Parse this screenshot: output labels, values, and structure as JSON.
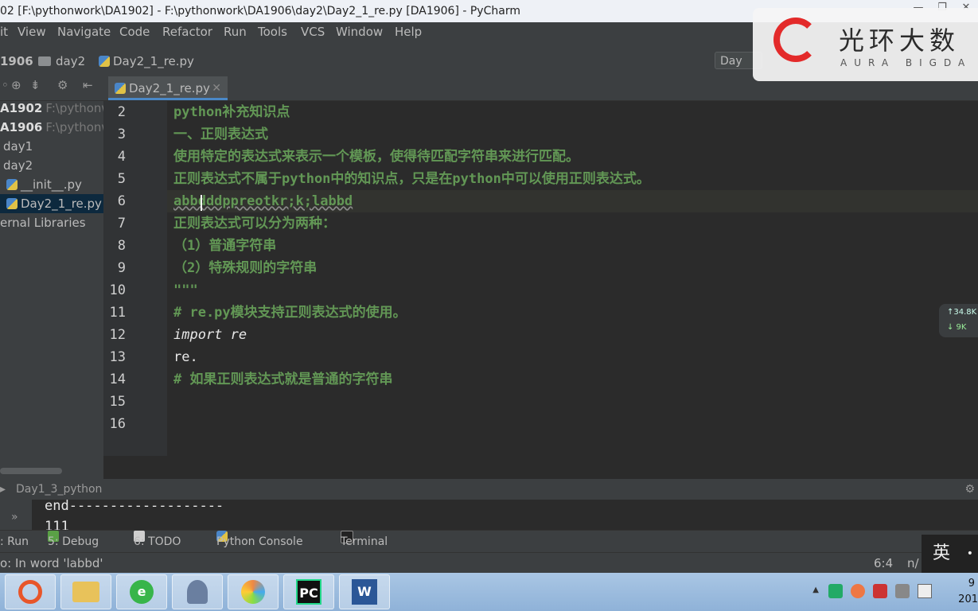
{
  "window": {
    "title": "02 [F:\\pythonwork\\DA1902] - F:\\pythonwork\\DA1906\\day2\\Day2_1_re.py [DA1906] - PyCharm",
    "controls": [
      "—",
      "❐",
      "✕"
    ]
  },
  "menu": [
    "it",
    "View",
    "Navigate",
    "Code",
    "Refactor",
    "Run",
    "Tools",
    "VCS",
    "Window",
    "Help"
  ],
  "nav": {
    "project": "1906",
    "folder": "day2",
    "file": "Day2_1_re.py",
    "run_config": "Day"
  },
  "project_panel": {
    "rows": [
      {
        "name": "A1902",
        "path": "F:\\pythonw"
      },
      {
        "name": "A1906",
        "path": "F:\\pythonw"
      },
      {
        "name": "day1",
        "path": ""
      },
      {
        "name": "day2",
        "path": ""
      },
      {
        "name": "__init__.py",
        "path": ""
      },
      {
        "name": "Day2_1_re.py",
        "path": ""
      },
      {
        "name": "ernal Libraries",
        "path": ""
      }
    ]
  },
  "editor": {
    "tab": "Day2_1_re.py",
    "line_numbers": [
      "2",
      "3",
      "4",
      "5",
      "6",
      "7",
      "8",
      "9",
      "10",
      "11",
      "12",
      "13",
      "14",
      "15",
      "16"
    ],
    "lines": [
      "python补充知识点",
      "一、正则表达式",
      "使用特定的表达式来表示一个模板，使得待匹配字符串来进行匹配。",
      "正则表达式不属于python中的知识点，只是在python中可以使用正则表达式。",
      "abbdddppreotkr;k;labbd",
      "正则表达式可以分为两种：",
      "（1）普通字符串",
      "（2）特殊规则的字符串",
      "\"\"\"",
      "# re.py模块支持正则表达式的使用。",
      "import re",
      "re.",
      "# 如果正则表达式就是普通的字符串",
      "",
      ""
    ]
  },
  "run": {
    "config": "Day1_3_python",
    "output": [
      "end-------------------",
      "111"
    ]
  },
  "toolwindows": [
    {
      "label": ": Run"
    },
    {
      "label": "5: Debug"
    },
    {
      "label": "6: TODO"
    },
    {
      "label": "Python Console"
    },
    {
      "label": "Terminal"
    }
  ],
  "status": {
    "message": "o: In word 'labbd'",
    "position": "6:4",
    "extra": "n/"
  },
  "taskbar": {
    "apps": [
      "Chrome",
      "Explorer",
      "IE",
      "User",
      "Paint",
      "PC",
      "W"
    ],
    "time": "9",
    "date": "201"
  },
  "watermark": {
    "cn": "光环大数",
    "en": "AURA BIGDA"
  },
  "net": {
    "up": "↑34.8K",
    "down": "↓ 9K"
  },
  "ime": "英",
  "colors": {
    "editor_bg": "#2b2b2b",
    "docstring": "#629755",
    "panel": "#3c3f41"
  }
}
